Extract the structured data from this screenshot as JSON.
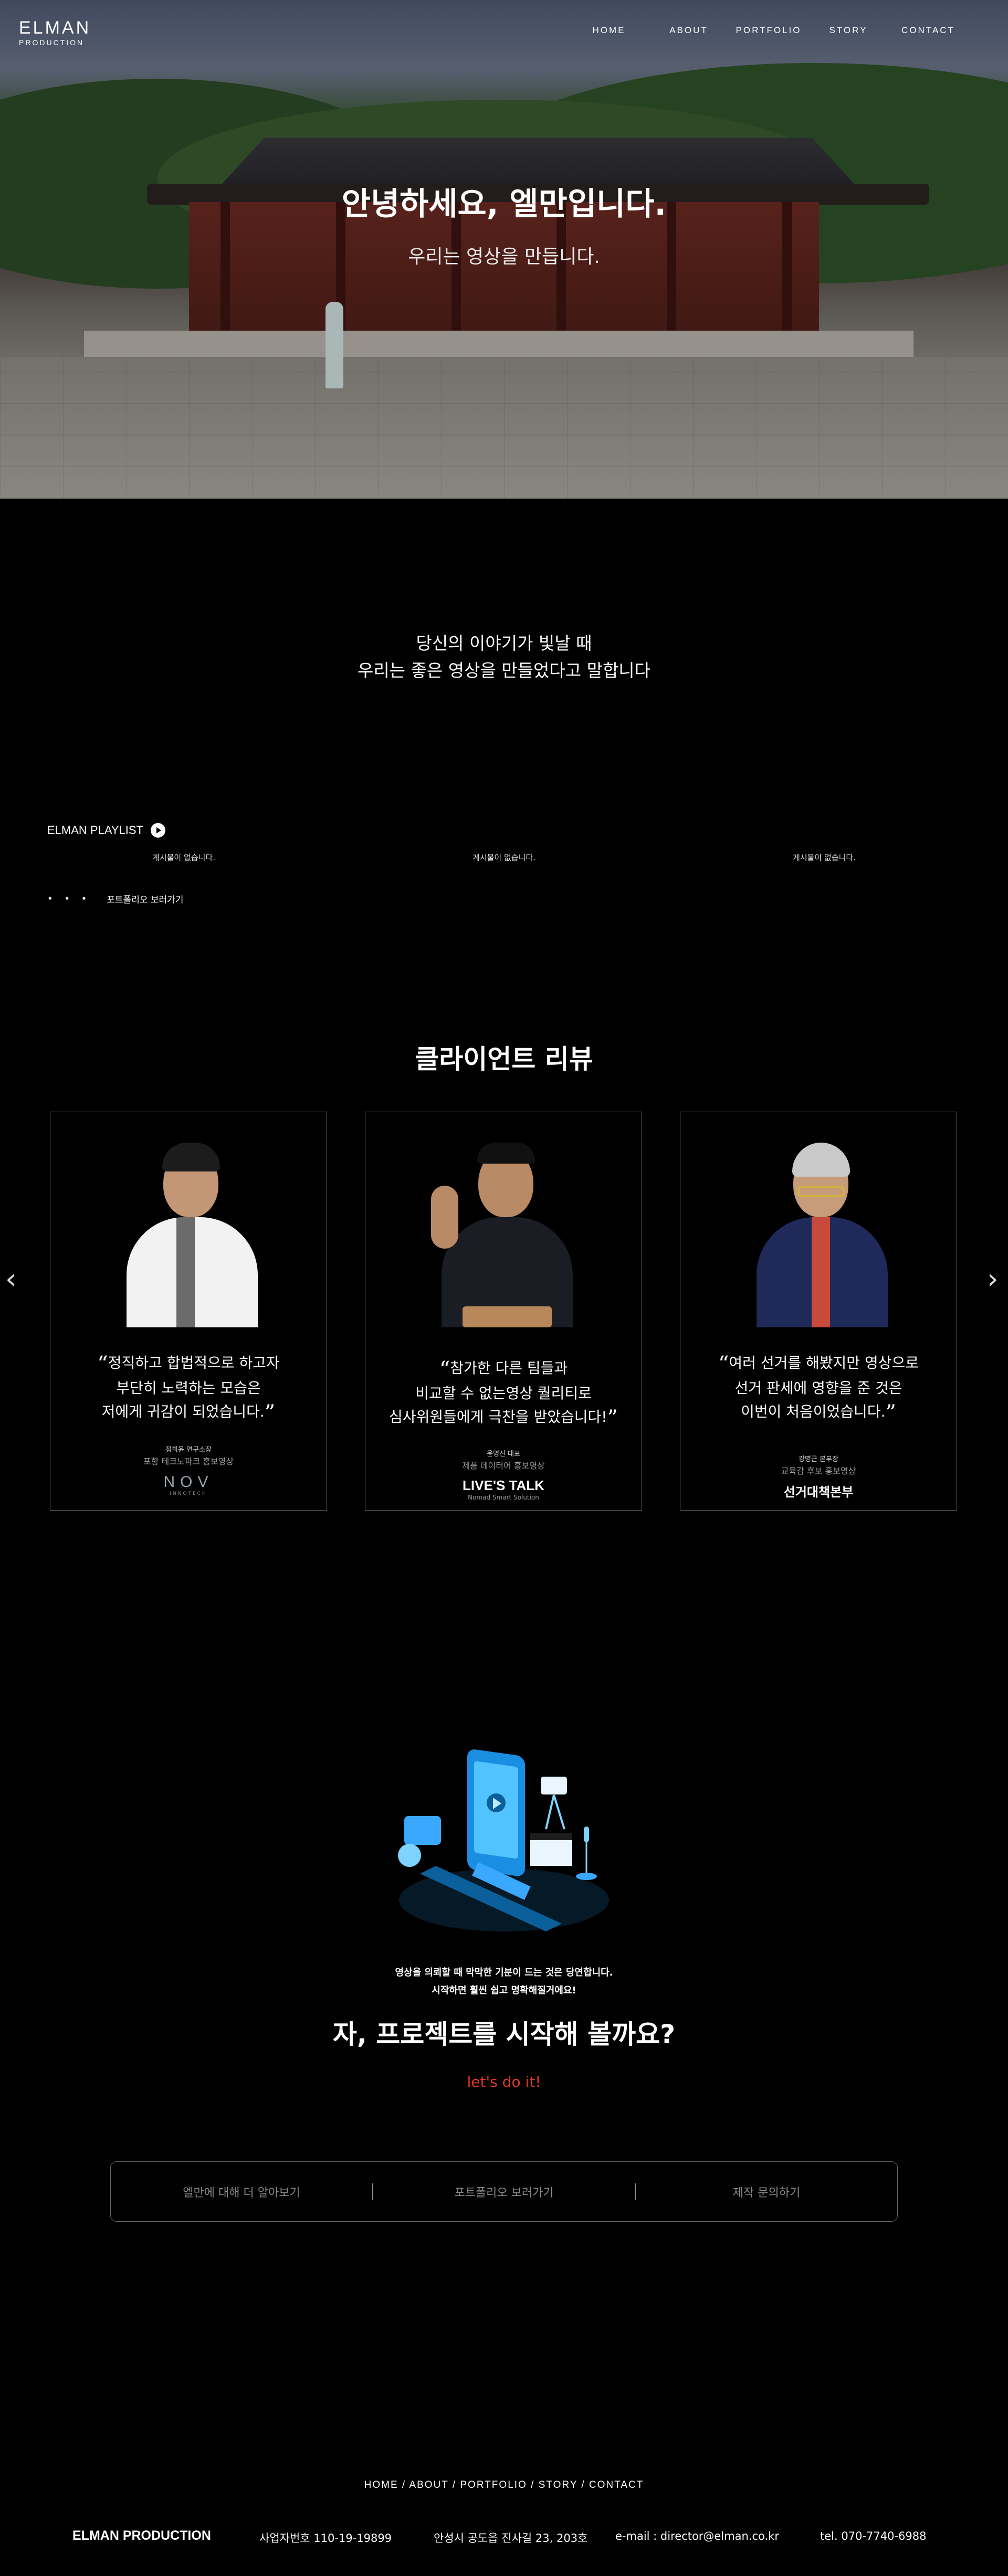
{
  "header": {
    "logo_line1": "ELMAN",
    "logo_line2": "PRODUCTION",
    "nav": [
      "HOME",
      "ABOUT",
      "PORTFOLIO",
      "STORY",
      "CONTACT"
    ]
  },
  "hero": {
    "title": "안녕하세요, 엘만입니다.",
    "subtitle": "우리는 영상을 만듭니다."
  },
  "tagline": {
    "line1": "당신의 이야기가 빛날 때",
    "line2": "우리는 좋은 영상을 만들었다고 말합니다"
  },
  "playlist": {
    "label": "ELMAN PLAYLIST",
    "empty_messages": [
      "게시물이 없습니다.",
      "게시물이 없습니다.",
      "게시물이 없습니다."
    ],
    "dots": "• • •",
    "portfolio_link": "포트폴리오 보러가기"
  },
  "reviews": {
    "title": "클라이언트 리뷰",
    "prev_icon": "chevron-left-icon",
    "next_icon": "chevron-right-icon",
    "cards": [
      {
        "quote_lines": [
          "정직하고 합법적으로 하고자",
          "부단히 노력하는 모습은",
          "저에게 귀감이 되었습니다."
        ],
        "role": "정희윤 연구소장",
        "project": "포항 테크노파크 홍보영상",
        "brand_main": "NOV",
        "brand_sub": "INNOTECH"
      },
      {
        "quote_lines": [
          "참가한 다른 팀들과",
          "비교할 수 없는영상 퀄리티로",
          "심사위원들에게 극찬을 받았습니다!"
        ],
        "role": "윤영진 대표",
        "project": "제품 데이터어 홍보영상",
        "brand_main": "LIVE'S TALK",
        "brand_sub": "Nomad Smart Solution"
      },
      {
        "quote_lines": [
          "여러 선거를 해봤지만 영상으로",
          "선거 판세에 영향을 준 것은",
          "이번이 처음이었습니다."
        ],
        "role": "강명근 본부장",
        "project": "교육감 후보 홍보영상",
        "brand_main": "선거대책본부",
        "brand_sub": ""
      }
    ]
  },
  "cta": {
    "note_line1": "영상을 의뢰할 때 막막한 기분이 드는 것은 당연합니다.",
    "note_line2": "시작하면 훨씬 쉽고 명확해질거에요!",
    "title": "자, 프로젝트를 시작해 볼까요?",
    "go": "let's do it!",
    "options": [
      "엘만에 대해 더 알아보기",
      "포트폴리오 보러가기",
      "제작 문의하기"
    ]
  },
  "footer": {
    "nav": "HOME / ABOUT / PORTFOLIO / STORY / CONTACT",
    "brand": "ELMAN PRODUCTION",
    "business_no": "사업자번호 110-19-19899",
    "address": "안성시 공도읍 진사길 23, 203호",
    "email": "e-mail : director@elman.co.kr",
    "tel": "tel. 070-7740-6988"
  },
  "colors": {
    "accent": "#e0391d",
    "card_border": "#6b6b6b",
    "background": "#000000"
  }
}
